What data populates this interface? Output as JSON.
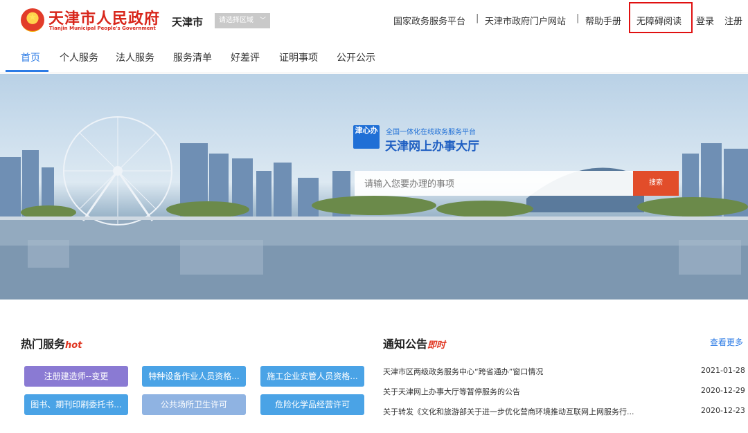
{
  "header": {
    "gov_name": "天津市人民政府",
    "gov_name_en": "Tianjin Municipal People's Government",
    "city": "天津市",
    "region_placeholder": "请选择区域",
    "links": [
      "国家政务服务平台",
      "天津市政府门户网站",
      "帮助手册",
      "无障碍阅读",
      "登录",
      "注册"
    ],
    "separator": "|"
  },
  "nav": {
    "items": [
      "首页",
      "个人服务",
      "法人服务",
      "服务清单",
      "好差评",
      "证明事项",
      "公开公示"
    ],
    "active": "首页"
  },
  "banner": {
    "logo_text": "津心办",
    "subtitle": "全国一体化在线政务服务平台",
    "title": "天津网上办事大厅",
    "search_placeholder": "请输入您要办理的事项",
    "search_button": "搜索"
  },
  "hot_services": {
    "title": "热门服务",
    "tag": "hot",
    "items": [
      "注册建造师--变更",
      "特种设备作业人员资格...",
      "施工企业安管人员资格...",
      "图书、期刊印刷委托书...",
      "公共场所卫生许可",
      "危险化学品经营许可"
    ]
  },
  "notices": {
    "title": "通知公告",
    "tag": "即时",
    "more": "查看更多",
    "items": [
      {
        "text": "天津市区两级政务服务中心“跨省通办”窗口情况",
        "date": "2021-01-28"
      },
      {
        "text": "关于天津网上办事大厅等暂停服务的公告",
        "date": "2020-12-29"
      },
      {
        "text": "关于转发《文化和旅游部关于进一步优化营商环境推动互联网上网服务行...",
        "date": "2020-12-23"
      }
    ]
  },
  "colors": {
    "brand_red": "#d8261b",
    "nav_active": "#2c7be5",
    "search_button": "#e24d2a",
    "highlight_border": "#e01010"
  },
  "icons": [
    "national-emblem-icon",
    "chevron-down-icon"
  ]
}
